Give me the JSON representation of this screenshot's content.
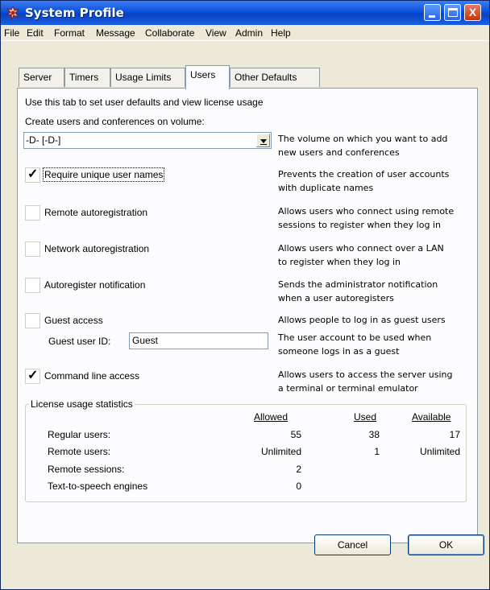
{
  "window": {
    "title": "System Profile",
    "controls": {
      "close_glyph": "X"
    }
  },
  "menu": [
    "File",
    "Edit",
    "Format",
    "Message",
    "Collaborate",
    "View",
    "Admin",
    "Help"
  ],
  "tabs": [
    "Server",
    "Timers",
    "Usage Limits",
    "Users",
    "Other Defaults"
  ],
  "active_tab": "Users",
  "panel": {
    "intro": "Use this tab to set user defaults and view license usage",
    "volume": {
      "label": "Create users and conferences on volume:",
      "selected": "-D- [-D-]",
      "desc_1": "The volume on which you want to add",
      "desc_2": "new users and conferences"
    },
    "options": [
      {
        "label": "Require unique user names",
        "checked": true,
        "check_glyph": "✓",
        "desc_1": "Prevents the creation of user accounts",
        "desc_2": "with duplicate names"
      },
      {
        "label": "Remote autoregistration",
        "checked": false,
        "check_glyph": "",
        "desc_1": "Allows users who connect using remote",
        "desc_2": "sessions to register when they log in"
      },
      {
        "label": "Network autoregistration",
        "checked": false,
        "check_glyph": "",
        "desc_1": "Allows users who connect over a LAN",
        "desc_2": "to register when they log in"
      },
      {
        "label": "Autoregister notification",
        "checked": false,
        "check_glyph": "",
        "desc_1": "Sends the administrator notification",
        "desc_2": "when a user autoregisters"
      },
      {
        "label": "Guest access",
        "checked": false,
        "check_glyph": "",
        "desc_1": "Allows people to log in as guest users",
        "desc_2": ""
      },
      {
        "label": "Command line access",
        "checked": true,
        "check_glyph": "✓",
        "desc_1": "Allows users to access the server using",
        "desc_2": "a terminal or terminal emulator"
      }
    ],
    "guest": {
      "label": "Guest user ID:",
      "value": "Guest",
      "desc_1": "The user account to be used when",
      "desc_2": "someone logs in as a guest"
    },
    "license": {
      "title": "License usage statistics",
      "headers": [
        "Allowed",
        "Used",
        "Available"
      ],
      "rows": [
        {
          "label": "Regular users:",
          "allowed": "55",
          "used": "38",
          "available": "17"
        },
        {
          "label": "Remote users:",
          "allowed": "Unlimited",
          "used": "1",
          "available": "Unlimited"
        },
        {
          "label": "Remote sessions:",
          "allowed": "2",
          "used": "",
          "available": ""
        },
        {
          "label": "Text-to-speech engines",
          "allowed": "0",
          "used": "",
          "available": ""
        }
      ]
    }
  },
  "buttons": {
    "cancel": "Cancel",
    "ok": "OK"
  }
}
